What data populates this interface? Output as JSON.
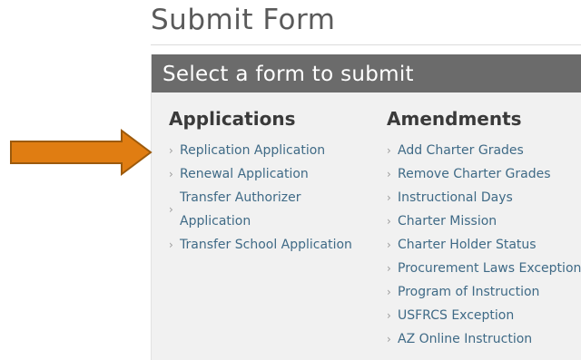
{
  "page": {
    "title": "Submit Form"
  },
  "panel": {
    "header": "Select a form to submit"
  },
  "applications": {
    "heading": "Applications",
    "items": [
      "Replication Application",
      "Renewal Application",
      "Transfer Authorizer\nApplication",
      "Transfer School Application"
    ]
  },
  "amendments": {
    "heading": "Amendments",
    "items": [
      "Add Charter Grades",
      "Remove Charter Grades",
      "Instructional Days",
      "Charter Mission",
      "Charter Holder Status",
      "Procurement Laws Exception",
      "Program of Instruction",
      "USFRCS Exception",
      "AZ Online Instruction"
    ]
  },
  "icons": {
    "bullet": "chevron-right-icon",
    "pointer": "arrow-right-icon"
  },
  "colors": {
    "link": "#3f6a86",
    "header_bg": "#6b6b6b",
    "panel_bg": "#f1f1f1",
    "arrow_fill": "#e07d12",
    "arrow_stroke": "#9c5a0c"
  }
}
